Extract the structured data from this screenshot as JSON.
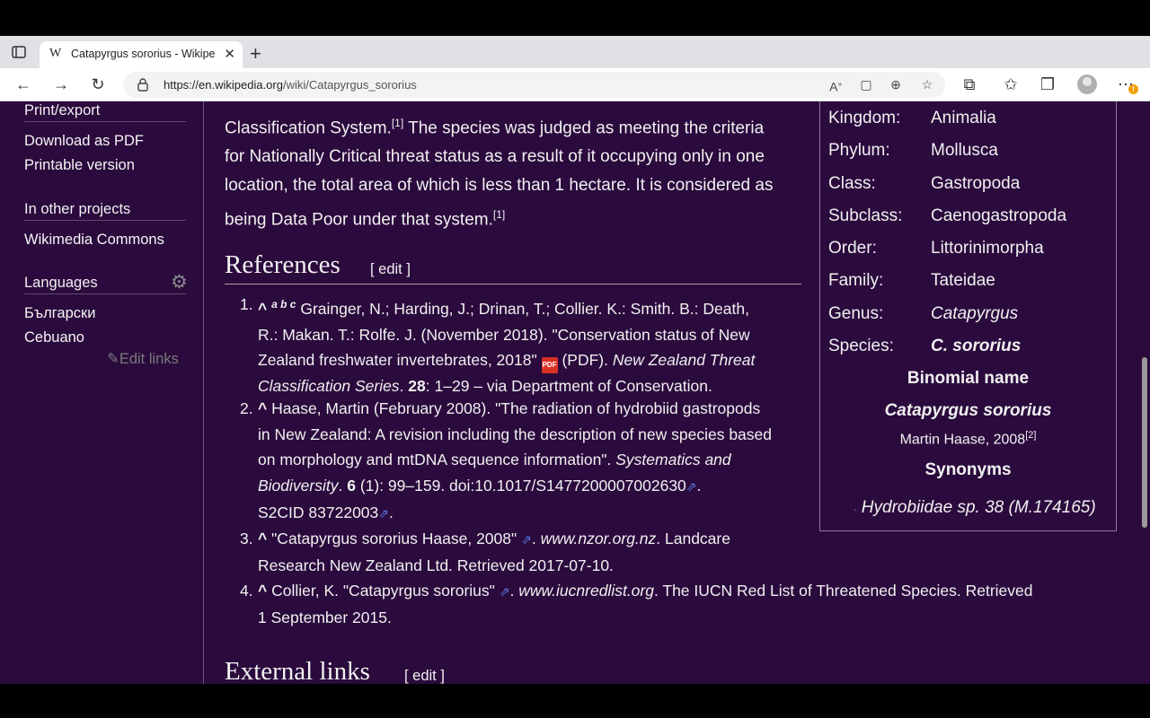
{
  "browser": {
    "tab_title": "Catapyrgus sororius - Wikipedia",
    "tab_favicon": "W",
    "url_host": "https://en.wikipedia.org",
    "url_path": "/wiki/Catapyrgus_sororius",
    "alert_badge": "!"
  },
  "sidebar": {
    "print_heading": "Print/export",
    "download_pdf": "Download as PDF",
    "printable": "Printable version",
    "other_projects_heading": "In other projects",
    "wikimedia_commons": "Wikimedia Commons",
    "languages_heading": "Languages",
    "lang_1": "Български",
    "lang_2": "Cebuano",
    "edit_links": "Edit links"
  },
  "content": {
    "para_line1_a": "Classification System.",
    "para_line1_sup": "[1]",
    "para_line1_b": " The species was judged as meeting the criteria",
    "para_line2": "for Nationally Critical threat status as a result of it occupying only in one",
    "para_line3": "location, the total area of which is less than 1 hectare. It is considered as",
    "para_line4": "being Data Poor under that system.",
    "para_line4_sup": "[1]",
    "references_heading": "References",
    "edit_label": "[ edit ]",
    "external_links_heading": "External links",
    "ref1": {
      "num": "1.",
      "caret": "^",
      "letters": "a b c",
      "line1": " Grainger, N.; Harding, J.; Drinan, T.; Collier. K.: Smith. B.: Death,",
      "line2": "R.: Makan. T.: Rolfe. J. (November 2018). \"Conservation status of New",
      "line3a": "Zealand freshwater invertebrates, 2018\"",
      "pdf_label": "PDF",
      "line3b": " (PDF). ",
      "line3c": "New Zealand Threat",
      "line4a": "Classification Series",
      "line4b": ". ",
      "line4c": "28",
      "line4d": ": 1–29 – via Department of Conservation."
    },
    "ref2": {
      "num": "2.",
      "caret": "^",
      "line1": " Haase, Martin (February 2008). \"The radiation of hydrobiid gastropods",
      "line2": "in New Zealand: A revision including the description of new species based",
      "line3a": "on morphology and mtDNA sequence information\". ",
      "line3b": "Systematics and",
      "line4a": "Biodiversity",
      "line4b": ". ",
      "line4c": "6",
      "line4d": " (1): 99–159. doi:10.1017/S1477200007002630",
      "line4e": ".",
      "line5a": "S2CID 83722003",
      "line5b": "."
    },
    "ref3": {
      "num": "3.",
      "caret": "^",
      "line1a": " \"Catapyrgus sororius Haase, 2008\"",
      "line1b": ". ",
      "line1c": "www.nzor.org.nz",
      "line1d": ". Landcare",
      "line2": "Research New Zealand Ltd. Retrieved 2017-07-10."
    },
    "ref4": {
      "num": "4.",
      "caret": "^",
      "line1a": " Collier, K. \"Catapyrgus sororius\"",
      "line1b": ". ",
      "line1c": "www.iucnredlist.org",
      "line1d": ". The IUCN Red List of Threatened Species. Retrieved",
      "line2": "1 September 2015."
    },
    "ext_icon": "⇗"
  },
  "infobox": {
    "rows": [
      {
        "label": "Kingdom:",
        "value": "Animalia"
      },
      {
        "label": "Phylum:",
        "value": "Mollusca"
      },
      {
        "label": "Class:",
        "value": "Gastropoda"
      },
      {
        "label": "Subclass:",
        "value": "Caenogastropoda"
      },
      {
        "label": "Order:",
        "value": "Littorinimorpha"
      },
      {
        "label": "Family:",
        "value": "Tateidae"
      },
      {
        "label": "Genus:",
        "value": "Catapyrgus"
      },
      {
        "label": "Species:",
        "value": "C. sororius"
      }
    ],
    "binomial_heading": "Binomial name",
    "binomial": "Catapyrgus sororius",
    "authority": "Martin Haase, 2008",
    "authority_sup": "[2]",
    "synonyms_heading": "Synonyms",
    "synonym": "Hydrobiidae sp. 38 (M.174165)"
  },
  "colors": {
    "page_bg": "#2b0a3d",
    "link_ext": "#5b7be6"
  },
  "icons": [
    "tab-toggle-icon",
    "close-icon",
    "plus-icon",
    "back-icon",
    "forward-icon",
    "refresh-icon",
    "lock-icon",
    "read-aloud-icon",
    "immersive-reader-icon",
    "zoom-icon",
    "favorite-add-icon",
    "extensions-icon",
    "favorites-icon",
    "collections-icon",
    "profile-icon",
    "more-icon",
    "gear-icon",
    "pencil-icon",
    "external-link-icon",
    "pdf-icon"
  ]
}
